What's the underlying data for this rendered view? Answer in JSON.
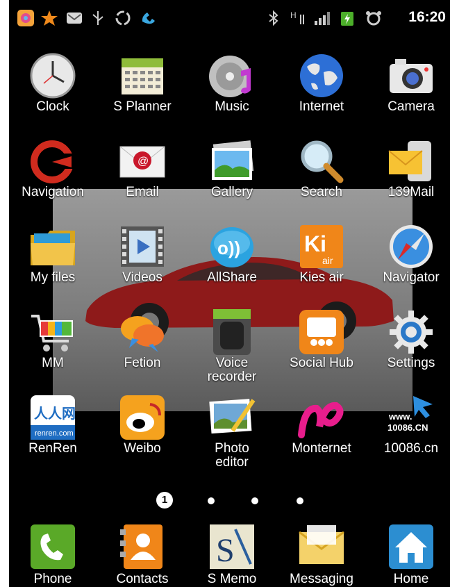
{
  "status_bar": {
    "time": "16:20",
    "left_icons": [
      "app-icon",
      "star-icon",
      "mail-icon",
      "usb-icon",
      "recycle-icon",
      "call-icon"
    ],
    "right_icons": [
      "bluetooth-icon",
      "data-icon",
      "signal-icon",
      "battery-icon",
      "alarm-icon"
    ]
  },
  "grid": [
    {
      "label": "Clock",
      "icon": "clock-icon"
    },
    {
      "label": "S Planner",
      "icon": "calendar-icon"
    },
    {
      "label": "Music",
      "icon": "music-icon"
    },
    {
      "label": "Internet",
      "icon": "globe-icon"
    },
    {
      "label": "Camera",
      "icon": "camera-icon"
    },
    {
      "label": "Navigation",
      "icon": "navigation-icon"
    },
    {
      "label": "Email",
      "icon": "email-icon"
    },
    {
      "label": "Gallery",
      "icon": "gallery-icon"
    },
    {
      "label": "Search",
      "icon": "search-icon"
    },
    {
      "label": "139Mail",
      "icon": "mail139-icon"
    },
    {
      "label": "My files",
      "icon": "folder-icon"
    },
    {
      "label": "Videos",
      "icon": "video-icon"
    },
    {
      "label": "AllShare",
      "icon": "allshare-icon"
    },
    {
      "label": "Kies air",
      "icon": "kies-icon",
      "text": "Ki",
      "subtext": "air"
    },
    {
      "label": "Navigator",
      "icon": "compass-icon"
    },
    {
      "label": "MM",
      "icon": "cart-icon"
    },
    {
      "label": "Fetion",
      "icon": "fetion-icon"
    },
    {
      "label": "Voice\nrecorder",
      "icon": "voice-recorder-icon"
    },
    {
      "label": "Social Hub",
      "icon": "social-hub-icon"
    },
    {
      "label": "Settings",
      "icon": "gear-icon"
    },
    {
      "label": "RenRen",
      "icon": "renren-icon",
      "text": "人人网",
      "subtext": "renren.com"
    },
    {
      "label": "Weibo",
      "icon": "weibo-icon"
    },
    {
      "label": "Photo\neditor",
      "icon": "photo-editor-icon"
    },
    {
      "label": "Monternet",
      "icon": "monternet-icon"
    },
    {
      "label": "10086.cn",
      "icon": "cn10086-icon",
      "text": "www.",
      "subtext": "10086.CN"
    }
  ],
  "pager": {
    "current": "1",
    "pages": 4
  },
  "dock": [
    {
      "label": "Phone",
      "icon": "phone-icon"
    },
    {
      "label": "Contacts",
      "icon": "contacts-icon"
    },
    {
      "label": "S Memo",
      "icon": "smemo-icon",
      "text": "S"
    },
    {
      "label": "Messaging",
      "icon": "messaging-icon"
    },
    {
      "label": "Home",
      "icon": "home-icon"
    }
  ]
}
